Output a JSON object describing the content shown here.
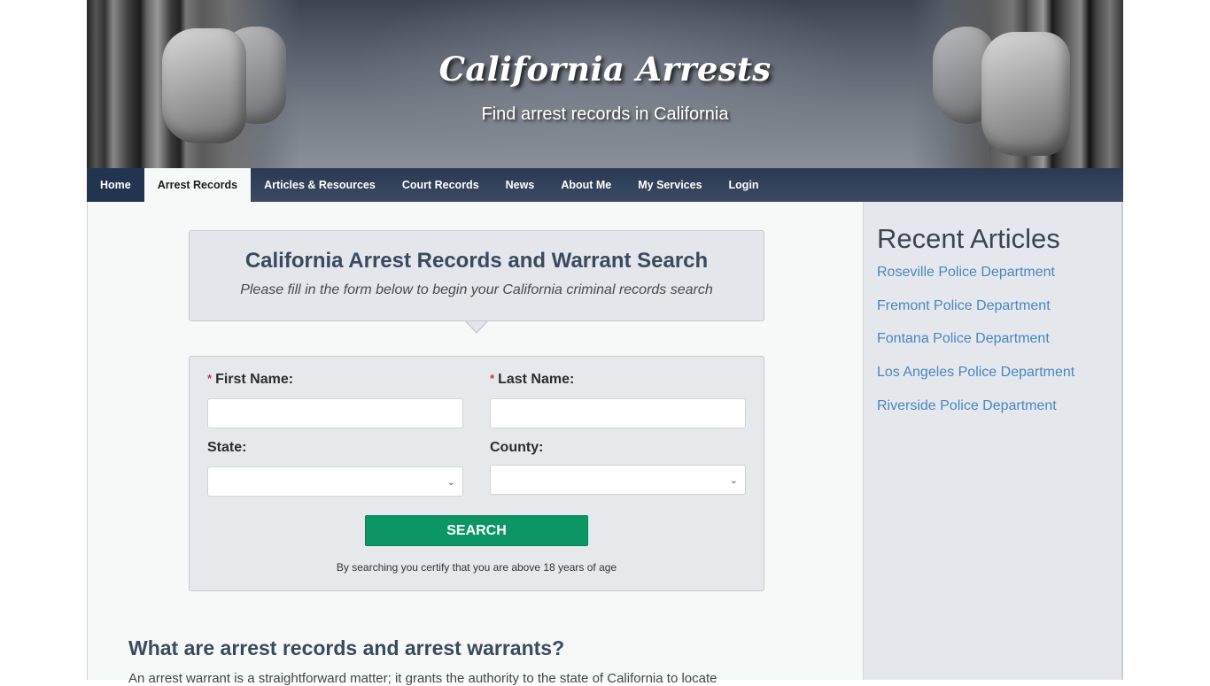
{
  "header": {
    "site_title": "California Arrests",
    "tagline": "Find arrest records in California"
  },
  "nav": {
    "items": [
      {
        "label": "Home"
      },
      {
        "label": "Arrest Records",
        "active": true
      },
      {
        "label": "Articles & Resources"
      },
      {
        "label": "Court Records"
      },
      {
        "label": "News"
      },
      {
        "label": "About Me"
      },
      {
        "label": "My Services"
      },
      {
        "label": "Login"
      }
    ]
  },
  "search_intro": {
    "title": "California Arrest Records and Warrant Search",
    "subtitle": "Please fill in the form below to begin your California criminal records search"
  },
  "search_form": {
    "required_marker": "*",
    "first_name": {
      "label": "First Name:",
      "value": "",
      "placeholder": ""
    },
    "last_name": {
      "label": "Last Name:",
      "value": "",
      "placeholder": ""
    },
    "state": {
      "label": "State:",
      "selected": ""
    },
    "county": {
      "label": "County:",
      "selected": ""
    },
    "submit_label": "SEARCH",
    "disclaimer": "By searching you certify that you are above 18 years of age"
  },
  "article": {
    "heading": "What are arrest records and arrest warrants?",
    "first_line": "An arrest warrant is a straightforward matter; it grants the authority to the state of California to locate"
  },
  "sidebar": {
    "title": "Recent Articles",
    "links": [
      {
        "label": "Roseville Police Department"
      },
      {
        "label": "Fremont Police Department"
      },
      {
        "label": "Fontana Police Department"
      },
      {
        "label": "Los Angeles Police Department"
      },
      {
        "label": "Riverside Police Department"
      }
    ]
  },
  "colors": {
    "nav_bg": "#2a3a52",
    "accent_green": "#0c9665",
    "link_blue": "#4a86c0",
    "heading": "#3a4a5e",
    "required_red": "#d0343a"
  }
}
